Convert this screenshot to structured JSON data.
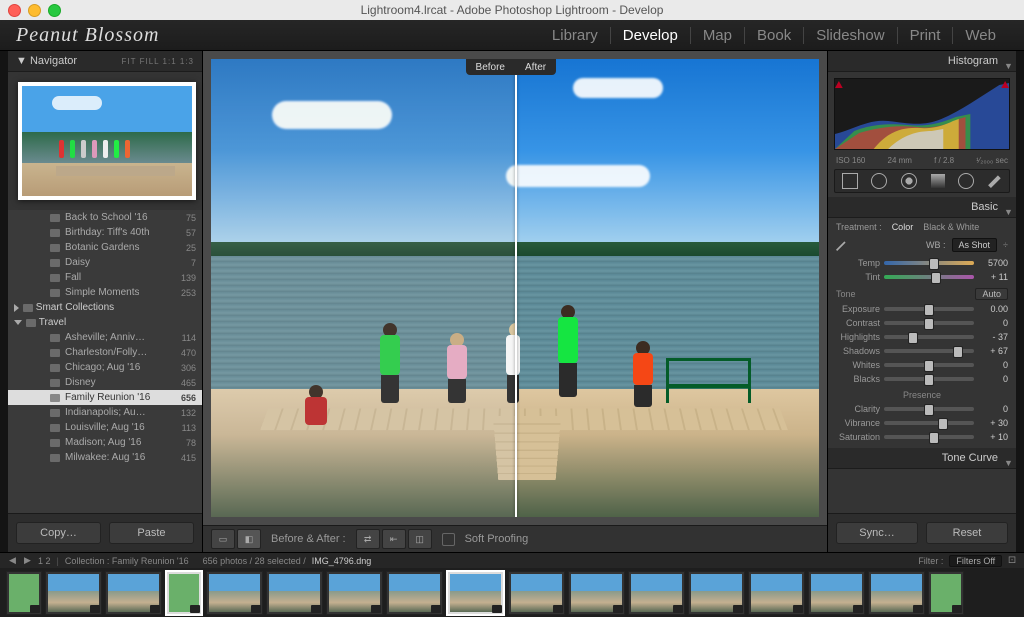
{
  "window": {
    "title": "Lightroom4.lrcat - Adobe Photoshop Lightroom - Develop"
  },
  "header": {
    "brand": "Peanut Blossom",
    "modules": [
      "Library",
      "Develop",
      "Map",
      "Book",
      "Slideshow",
      "Print",
      "Web"
    ],
    "active": "Develop"
  },
  "navigator": {
    "title": "Navigator",
    "fitfill": "FIT  FILL  1:1  1:3"
  },
  "folders": {
    "items": [
      {
        "name": "Back to School '16",
        "count": 75,
        "level": 2
      },
      {
        "name": "Birthday: Tiff's 40th",
        "count": 57,
        "level": 2
      },
      {
        "name": "Botanic Gardens",
        "count": 25,
        "level": 2
      },
      {
        "name": "Daisy",
        "count": 7,
        "level": 2
      },
      {
        "name": "Fall",
        "count": 139,
        "level": 2
      },
      {
        "name": "Simple Moments",
        "count": 253,
        "level": 2
      }
    ],
    "smart": "Smart Collections",
    "travel": "Travel",
    "travel_items": [
      {
        "name": "Asheville; Anniv…",
        "count": 114
      },
      {
        "name": "Charleston/Folly…",
        "count": 470
      },
      {
        "name": "Chicago; Aug '16",
        "count": 306
      },
      {
        "name": "Disney",
        "count": 465
      },
      {
        "name": "Family Reunion '16",
        "count": 656,
        "selected": true
      },
      {
        "name": "Indianapolis; Au…",
        "count": 132
      },
      {
        "name": "Louisville; Aug '16",
        "count": 113
      },
      {
        "name": "Madison; Aug '16",
        "count": 78
      },
      {
        "name": "Milwakee: Aug '16",
        "count": 415
      }
    ]
  },
  "leftfoot": {
    "copy": "Copy…",
    "paste": "Paste"
  },
  "beforeafter": {
    "before": "Before",
    "after": "After"
  },
  "ctoolbar": {
    "ba": "Before & After :",
    "soft": "Soft Proofing"
  },
  "rightfoot": {
    "sync": "Sync…",
    "reset": "Reset"
  },
  "histogram": {
    "title": "Histogram",
    "iso": "ISO 160",
    "focal": "24 mm",
    "ap": "f / 2.8",
    "sh": "¹⁄₂₀₀₀ sec"
  },
  "basic": {
    "title": "Basic",
    "treatment": "Treatment :",
    "color": "Color",
    "bw": "Black & White",
    "wb": "WB :",
    "wbval": "As Shot",
    "temp": {
      "label": "Temp",
      "value": "5700",
      "pos": 55
    },
    "tint": {
      "label": "Tint",
      "value": "+ 11",
      "pos": 58
    },
    "tone": "Tone",
    "auto": "Auto",
    "exposure": {
      "label": "Exposure",
      "value": "0.00",
      "pos": 50
    },
    "contrast": {
      "label": "Contrast",
      "value": "0",
      "pos": 50
    },
    "highlights": {
      "label": "Highlights",
      "value": "- 37",
      "pos": 32
    },
    "shadows": {
      "label": "Shadows",
      "value": "+ 67",
      "pos": 82
    },
    "whites": {
      "label": "Whites",
      "value": "0",
      "pos": 50
    },
    "blacks": {
      "label": "Blacks",
      "value": "0",
      "pos": 50
    },
    "presence": "Presence",
    "clarity": {
      "label": "Clarity",
      "value": "0",
      "pos": 50
    },
    "vibrance": {
      "label": "Vibrance",
      "value": "+ 30",
      "pos": 65
    },
    "saturation": {
      "label": "Saturation",
      "value": "+ 10",
      "pos": 55
    }
  },
  "tonecurve": "Tone Curve",
  "filmstrip": {
    "nav": "1  2",
    "collection": "Collection : Family Reunion '16",
    "count": "656 photos / 28 selected /",
    "file": "IMG_4796.dng",
    "filter": "Filter :",
    "filtersoff": "Filters Off"
  }
}
